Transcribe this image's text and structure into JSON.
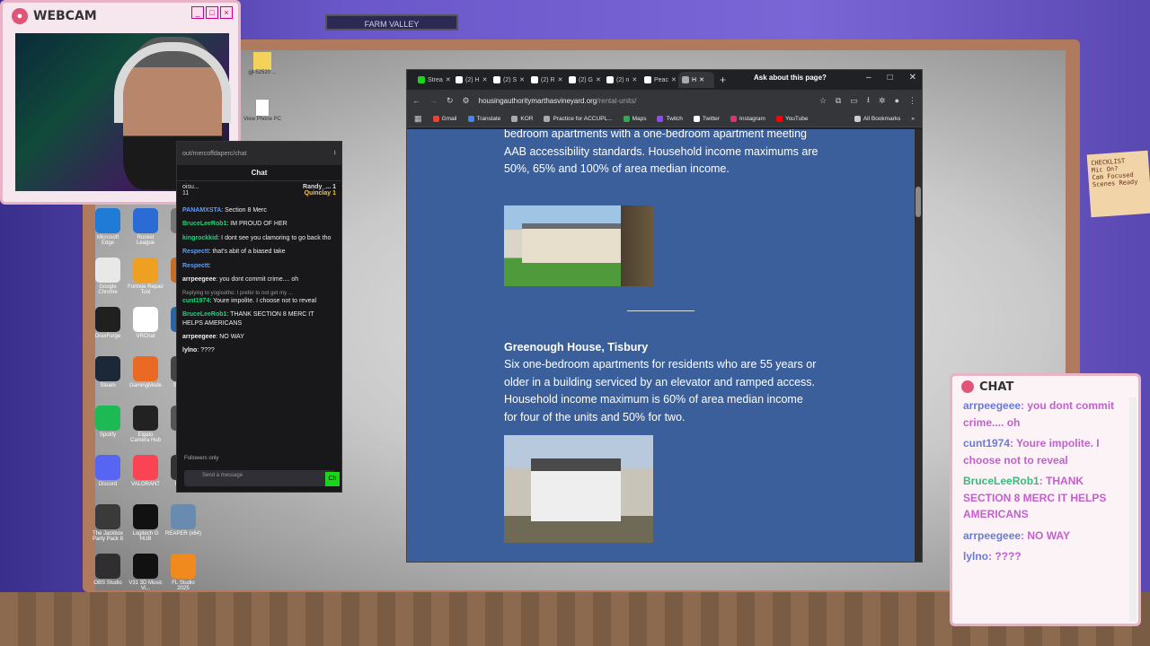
{
  "webcam": {
    "title": "WEBCAM"
  },
  "room": {
    "top_sign": "FARM VALLEY",
    "note": "CHECKLIST\nMic On?\nCam Focused\nScenes Ready"
  },
  "desktop": {
    "files": [
      {
        "label": "gjl-52520 ..."
      },
      {
        "label": "View Phone PC"
      }
    ],
    "icons": [
      {
        "label": "Microsoft Edge",
        "color": "#1f7bd6"
      },
      {
        "label": "Rocket League",
        "color": "#2a6bd6"
      },
      {
        "label": "Re...",
        "color": "#777777"
      },
      {
        "label": "Google Chrome",
        "color": "#e8e8e8"
      },
      {
        "label": "Fortnite Repair Tool",
        "color": "#f0a020"
      },
      {
        "label": "Co...",
        "color": "#c46c2a"
      },
      {
        "label": "DraxForge",
        "color": "#202020"
      },
      {
        "label": "VRChat",
        "color": "#ffffff"
      },
      {
        "label": "Stea...",
        "color": "#2b64a0"
      },
      {
        "label": "Steam",
        "color": "#1b2838"
      },
      {
        "label": "GamingMode",
        "color": "#ea6a24"
      },
      {
        "label": "Steam...",
        "color": "#444444"
      },
      {
        "label": "Spotify",
        "color": "#1db954"
      },
      {
        "label": "Elgato Camera Hub",
        "color": "#222222"
      },
      {
        "label": "TH...",
        "color": "#555555"
      },
      {
        "label": "Discord",
        "color": "#5865f2"
      },
      {
        "label": "VALORANT",
        "color": "#fa4454"
      },
      {
        "label": "Meta...",
        "color": "#333333"
      },
      {
        "label": "The Jackbox Party Pack 8",
        "color": "#3a3a3a"
      },
      {
        "label": "Logitech G HUB",
        "color": "#111111"
      },
      {
        "label": "REAPER (x64)",
        "color": "#6a8bb0"
      },
      {
        "label": "OBS Studio",
        "color": "#302e31"
      },
      {
        "label": "V31 3D Music Vi...",
        "color": "#111111"
      },
      {
        "label": "FL Studio 2025",
        "color": "#f08a1f"
      }
    ]
  },
  "twitch_chat": {
    "url": "out/mercoffdaperc/chat",
    "header": "Chat",
    "top_users": [
      "Randy_... 1",
      "Quinclay 1"
    ],
    "top_partial": "oisu...",
    "top_count": "11",
    "messages": [
      {
        "user": "PANAMXSTA",
        "text": ": Section 8 Merc",
        "color": "#5a9cff"
      },
      {
        "user": "BruceLeeRob1",
        "text": ": IM PROUD OF HER",
        "color": "#1fd47a"
      },
      {
        "user": "kingrockkid",
        "text": ": I dont see you clamoring to go back tho",
        "color": "#1fd47a"
      },
      {
        "user": "Respectt",
        "text": ": that's abit of a biased take",
        "color": "#5a9cff"
      },
      {
        "user": "Respectt",
        "text": ":",
        "color": "#5a9cff"
      },
      {
        "user": "arrpeegeee",
        "text": ": you dont commit crime.... oh",
        "color": "#efeff1"
      },
      {
        "user": "cunt1974",
        "text": ": Youre impolite. I choose not to reveal",
        "color": "#1fd47a",
        "reply": "Replying to yogisotho: I prefer to not get my ..."
      },
      {
        "user": "BruceLeeRob1",
        "text": ": THANK SECTION 8 MERC IT HELPS AMERICANS",
        "color": "#1fd47a"
      },
      {
        "user": "arrpeegeee",
        "text": ": NO WAY",
        "color": "#efeff1"
      },
      {
        "user": "lylno",
        "text": ": ????",
        "color": "#efeff1"
      }
    ],
    "followers_only": "Followers only",
    "input_placeholder": "Send a message",
    "chat_button": "Ch"
  },
  "browser": {
    "tabs": [
      {
        "label": "Strea",
        "color": "#1bd41b"
      },
      {
        "label": "(2) H",
        "color": "#ffffff"
      },
      {
        "label": "(2) S",
        "color": "#ffffff"
      },
      {
        "label": "(2) R",
        "color": "#ffffff"
      },
      {
        "label": "(2) G",
        "color": "#ffffff"
      },
      {
        "label": "(2) n",
        "color": "#ffffff"
      },
      {
        "label": "Peac",
        "color": "#ffffff"
      },
      {
        "label": "H",
        "color": "#aaaaaa"
      }
    ],
    "ask": "Ask about this page?",
    "url_domain": "housingauthoritymarthasvineyard.org",
    "url_path": "/rental-units/",
    "bookmarks": [
      {
        "label": "Gmail",
        "color": "#ea4335"
      },
      {
        "label": "Translate",
        "color": "#4285f4"
      },
      {
        "label": "KOR",
        "color": "#aaaaaa"
      },
      {
        "label": "Practice for ACCUPL...",
        "color": "#aaaaaa"
      },
      {
        "label": "Maps",
        "color": "#34a853"
      },
      {
        "label": "Twitch",
        "color": "#9146ff"
      },
      {
        "label": "Twitter",
        "color": "#ffffff"
      },
      {
        "label": "Instagram",
        "color": "#e1306c"
      },
      {
        "label": "YouTube",
        "color": "#ff0000"
      },
      {
        "label": "All Bookmarks",
        "color": "#cccccc"
      }
    ],
    "page": {
      "paragraph1": "bedroom apartments with a one-bedroom apartment meeting AAB accessibility standards. Household income maximums are 50%, 65% and 100% of area median income.",
      "heading2": "Greenough House, Tisbury",
      "paragraph2": "Six one-bedroom apartments for residents who are 55 years or older in a building serviced by an elevator and ramped access. Household income maximum is 60% of area median income for four of the units and 50% for two."
    }
  },
  "stream_chat": {
    "title": "CHAT",
    "messages": [
      {
        "user": "arrpeegeee",
        "text": ": you dont commit crime.... oh",
        "style": "plain"
      },
      {
        "user": "cunt1974",
        "text": ": Youre impolite. I choose not to reveal",
        "style": "plain"
      },
      {
        "user": "BruceLeeRob1",
        "text": ": THANK SECTION 8 MERC IT HELPS AMERICANS",
        "style": "green"
      },
      {
        "user": "arrpeegeee",
        "text": ": NO WAY",
        "style": "plain"
      },
      {
        "user": "lylno",
        "text": ": ????",
        "style": "plain"
      }
    ]
  }
}
